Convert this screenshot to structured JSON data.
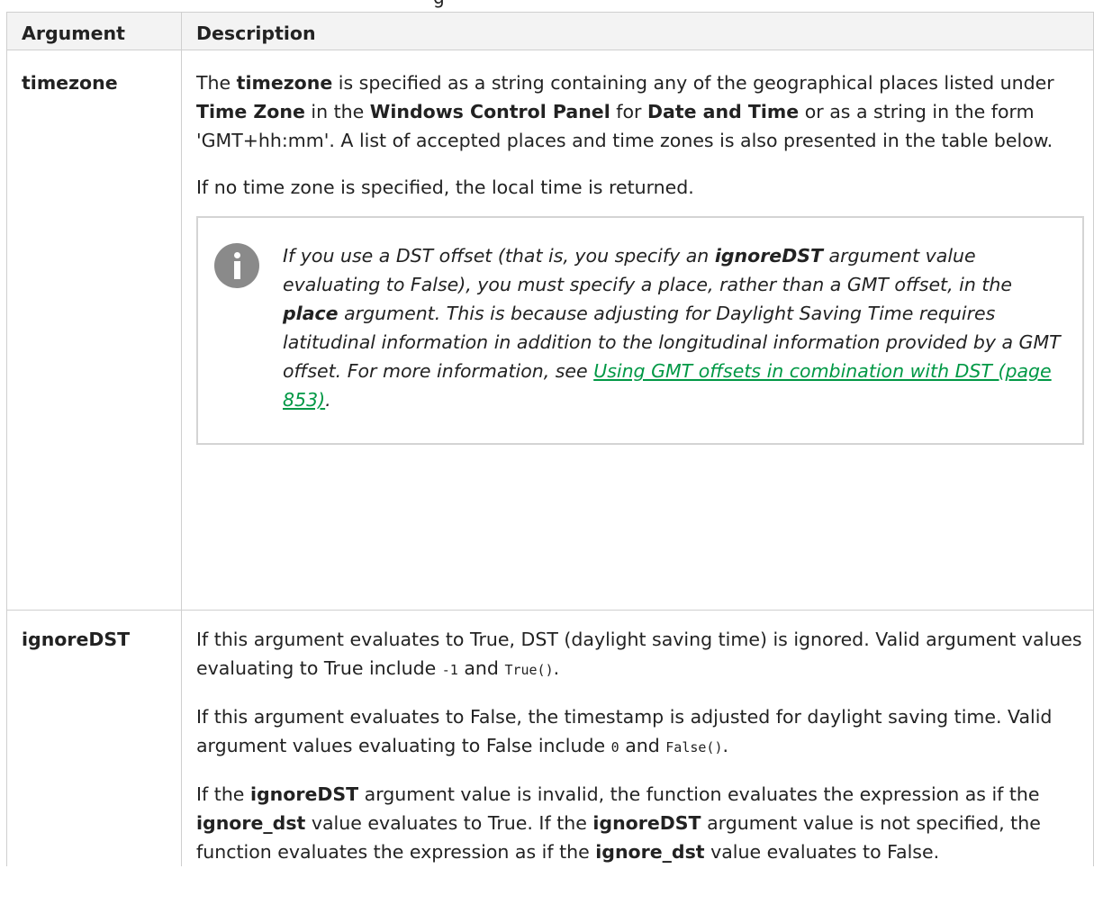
{
  "caption_tail": "g",
  "table": {
    "headers": {
      "argument": "Argument",
      "description": "Description"
    },
    "rows": {
      "timezone": {
        "name": "timezone",
        "p1": {
          "t1": "The ",
          "b1": "timezone",
          "t2": " is specified as a string containing any of the geographical places listed under ",
          "b2": "Time Zone",
          "t3": " in the ",
          "b3": "Windows Control Panel",
          "t4": " for ",
          "b4": "Date and Time",
          "t5": " or as a string in the form 'GMT+hh:mm'. A list of accepted places and time zones is also presented in the table below."
        },
        "p2": "If no time zone is specified, the local time is returned.",
        "note": {
          "t1": "If you use a DST offset (that is, you specify an ",
          "b1": "ignoreDST",
          "t2": " argument value evaluating to False), you must specify a place, rather than a GMT offset, in the ",
          "b2": "place",
          "t3": " argument. This is because adjusting for Daylight Saving Time requires latitudinal information in addition to the longitudinal information provided by a GMT offset. For more information, see ",
          "link": "Using GMT offsets in combination with DST (page 853)",
          "t4": "."
        }
      },
      "ignoredst": {
        "name": "ignoreDST",
        "p1": {
          "t1": "If this argument evaluates to True, DST (daylight saving time) is ignored. Valid argument values evaluating to True include ",
          "c1": "-1",
          "t2": " and ",
          "c2": "True()",
          "t3": "."
        },
        "p2": {
          "t1": "If this argument evaluates to False, the timestamp is adjusted for daylight saving time. Valid argument values evaluating to False include ",
          "c1": "0",
          "t2": " and ",
          "c2": "False()",
          "t3": "."
        },
        "p3": {
          "t1": "If the ",
          "b1": "ignoreDST",
          "t2": " argument value is invalid, the function evaluates the expression as if the ",
          "b2": "ignore_dst",
          "t3": " value evaluates to True. If the ",
          "b3": "ignoreDST",
          "t4": " argument value is not specified, the function evaluates the expression as if the ",
          "b4": "ignore_dst",
          "t5": " value evaluates to False."
        }
      }
    }
  }
}
